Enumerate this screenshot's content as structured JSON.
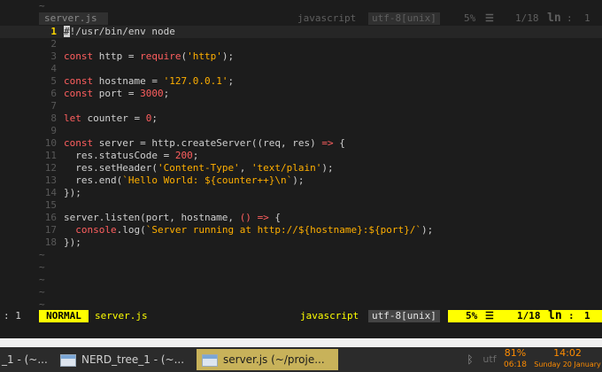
{
  "tabline": {
    "filename": "server.js",
    "filetype": "javascript",
    "encoding": "utf-8[unix]",
    "percent": "5%",
    "position": "1/18",
    "ln_label": "ln",
    "column": "1",
    "left_fragment": ": 1"
  },
  "editor": {
    "lines": [
      "#!/usr/bin/env node",
      "",
      "const http = require('http');",
      "",
      "const hostname = '127.0.0.1';",
      "const port = 3000;",
      "",
      "let counter = 0;",
      "",
      "const server = http.createServer((req, res) => {",
      "  res.statusCode = 200;",
      "  res.setHeader('Content-Type', 'text/plain');",
      "  res.end(`Hello World: ${counter++}\\n`);",
      "});",
      "",
      "server.listen(port, hostname, () => {",
      "  console.log(`Server running at http://${hostname}:${port}/`);",
      "});"
    ],
    "tilde": "~"
  },
  "statusline": {
    "left_fragment": ": 1",
    "mode": "NORMAL",
    "filename": "server.js",
    "filetype": "javascript",
    "encoding": "utf-8[unix]",
    "percent": "5%",
    "position": "1/18",
    "ln_label": "ln",
    "column": "1"
  },
  "taskbar": {
    "tasks": [
      {
        "label": "_1 - (~..."
      },
      {
        "label": "NERD_tree_1 - (~..."
      },
      {
        "label": "server.js (~/proje..."
      }
    ],
    "battery_percent": "81%",
    "battery_time": "06:18",
    "clock_time": "14:02",
    "clock_date": "Sunday 20 January",
    "tray_fragment": "utf"
  },
  "colors": {
    "accent_yellow": "#ffff00",
    "active_task": "#c8b25a",
    "tray_orange": "#ff8c00"
  }
}
